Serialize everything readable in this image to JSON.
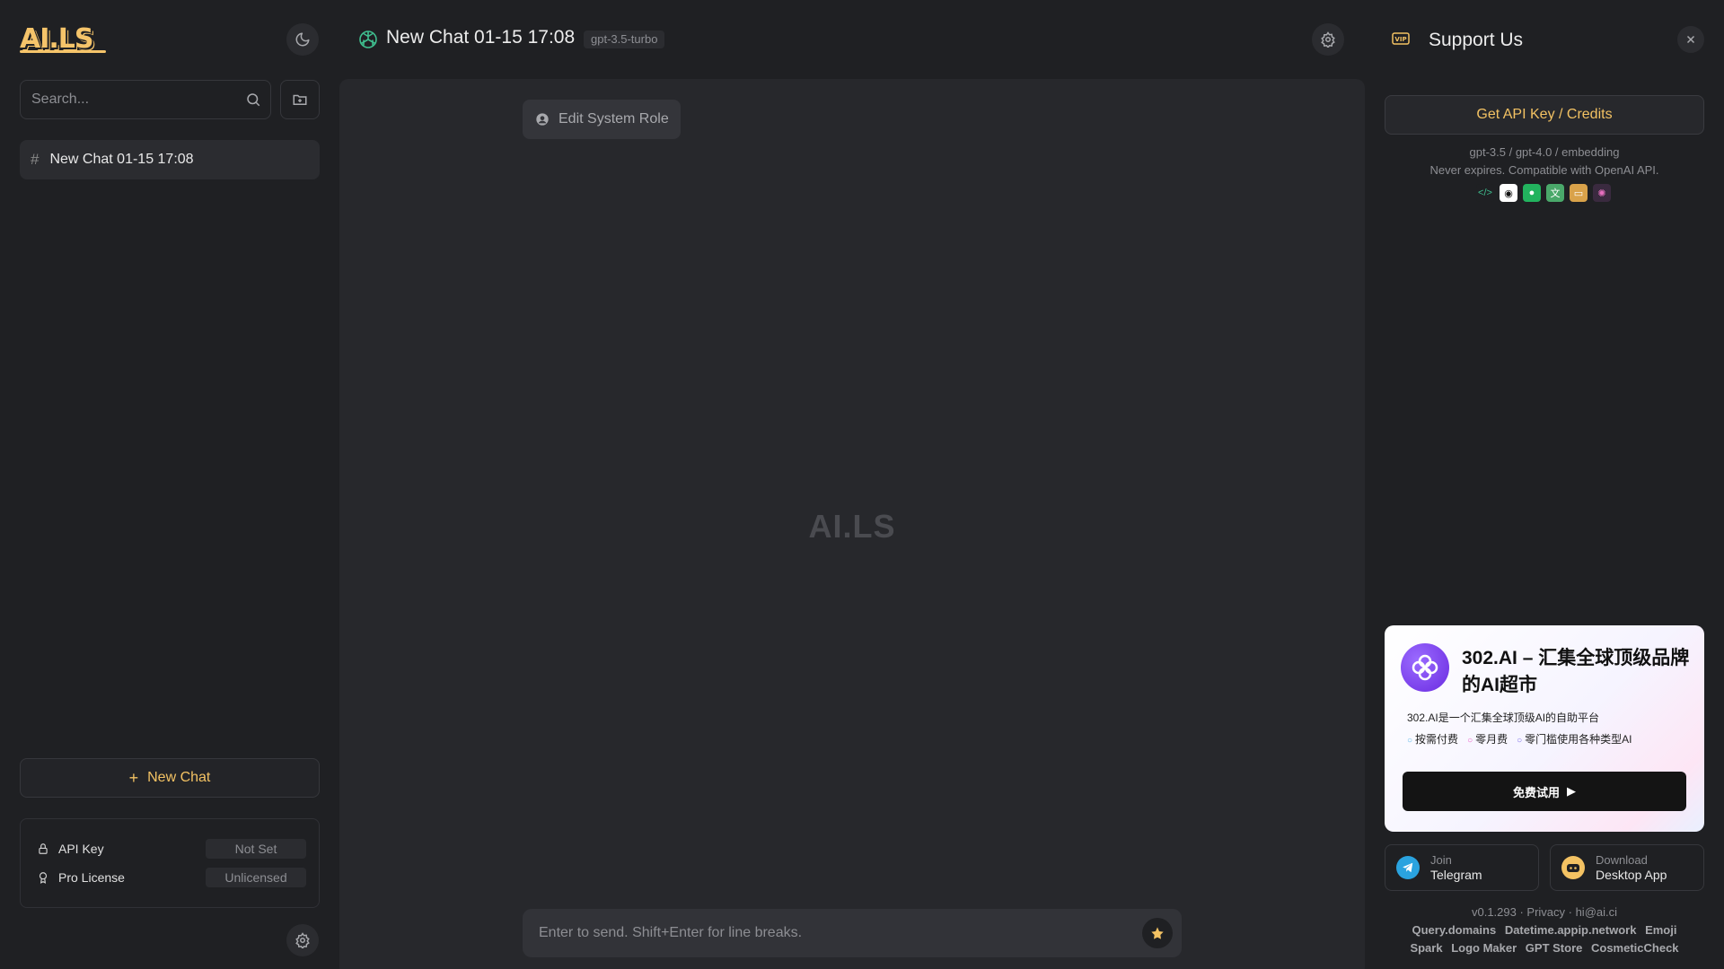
{
  "sidebar": {
    "logo": "AI.LS",
    "search_placeholder": "Search...",
    "chats": [
      {
        "label": "New Chat 01-15 17:08"
      }
    ],
    "new_chat_label": "New Chat",
    "status": {
      "api_key_label": "API Key",
      "api_key_value": "Not Set",
      "license_label": "Pro License",
      "license_value": "Unlicensed"
    }
  },
  "header": {
    "title": "New Chat 01-15 17:08",
    "model": "gpt-3.5-turbo"
  },
  "main": {
    "edit_role_label": "Edit System Role",
    "watermark": "AI.LS",
    "input_placeholder": "Enter to send. Shift+Enter for line breaks."
  },
  "support": {
    "title": "Support Us",
    "api_button": "Get API Key / Credits",
    "api_line1": "gpt-3.5 / gpt-4.0 / embedding",
    "api_line2": "Never expires. Compatible with OpenAI API.",
    "ad": {
      "title": "302.AI – 汇集全球顶级品牌的AI超市",
      "desc": "302.AI是一个汇集全球顶级AI的自助平台",
      "tags": [
        "按需付费",
        "零月费",
        "零门槛使用各种类型AI"
      ],
      "cta": "免费试用"
    },
    "telegram": {
      "line1": "Join",
      "line2": "Telegram"
    },
    "desktop": {
      "line1": "Download",
      "line2": "Desktop App"
    },
    "version_line": "v0.1.293 · Privacy · hi@ai.ci",
    "links_row1": [
      "Query.domains",
      "Datetime.appip.network",
      "Emoji"
    ],
    "links_row2": [
      "Spark",
      "Logo Maker",
      "GPT Store",
      "CosmeticCheck"
    ]
  },
  "colors": {
    "accent": "#f3c263",
    "background": "#1f2023",
    "panel": "#27282c"
  }
}
